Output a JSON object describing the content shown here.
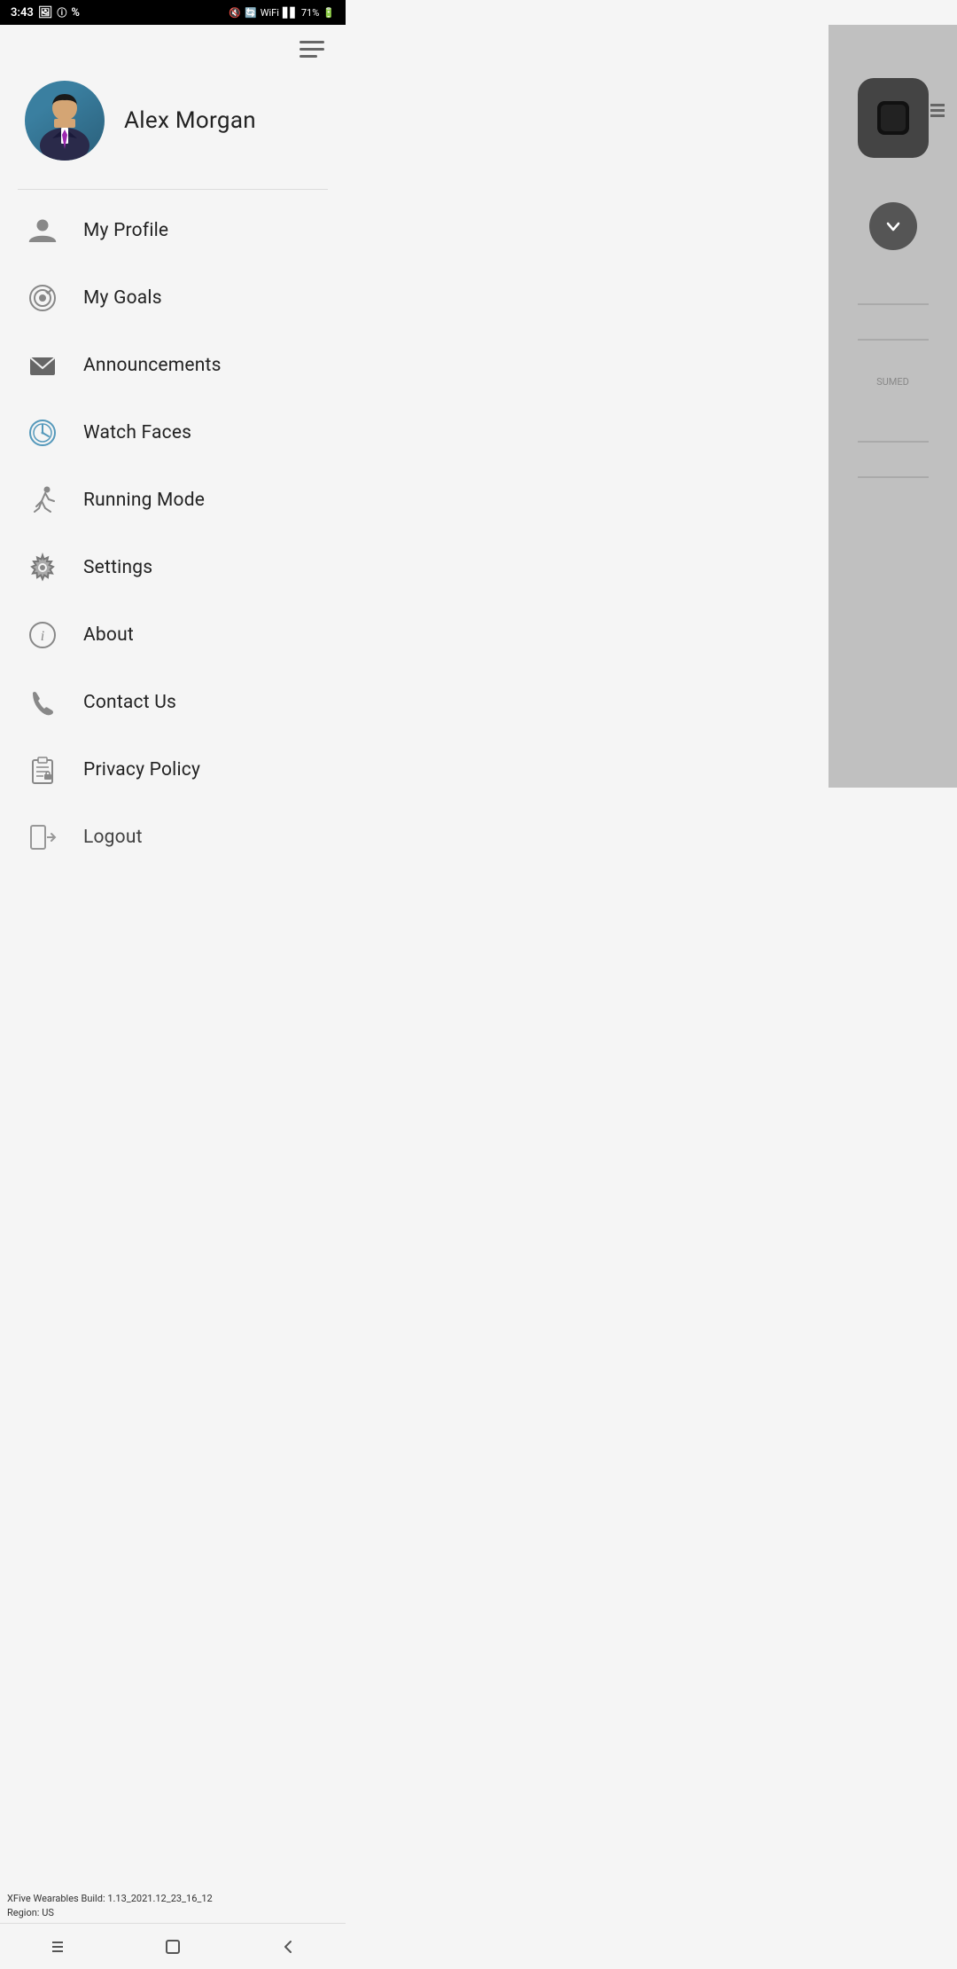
{
  "statusBar": {
    "time": "3:43",
    "battery": "71%"
  },
  "header": {
    "menuIcon": "hamburger-menu"
  },
  "profile": {
    "name": "Alex Morgan",
    "avatarAlt": "user-avatar"
  },
  "menuItems": [
    {
      "id": "my-profile",
      "label": "My Profile",
      "icon": "person-icon"
    },
    {
      "id": "my-goals",
      "label": "My Goals",
      "icon": "target-icon"
    },
    {
      "id": "announcements",
      "label": "Announcements",
      "icon": "mail-icon"
    },
    {
      "id": "watch-faces",
      "label": "Watch Faces",
      "icon": "clock-icon"
    },
    {
      "id": "running-mode",
      "label": "Running Mode",
      "icon": "run-icon"
    },
    {
      "id": "settings",
      "label": "Settings",
      "icon": "gear-icon"
    },
    {
      "id": "about",
      "label": "About",
      "icon": "info-icon"
    },
    {
      "id": "contact-us",
      "label": "Contact Us",
      "icon": "phone-icon"
    },
    {
      "id": "privacy-policy",
      "label": "Privacy Policy",
      "icon": "clipboard-icon"
    },
    {
      "id": "logout",
      "label": "Logout",
      "icon": "logout-icon"
    }
  ],
  "buildInfo": {
    "line1": "XFive Wearables Build: 1.13_2021.12_23_16_12",
    "line2": "Region: US"
  },
  "bottomNav": {
    "recentBtn": "|||",
    "homeBtn": "□",
    "backBtn": "<"
  }
}
